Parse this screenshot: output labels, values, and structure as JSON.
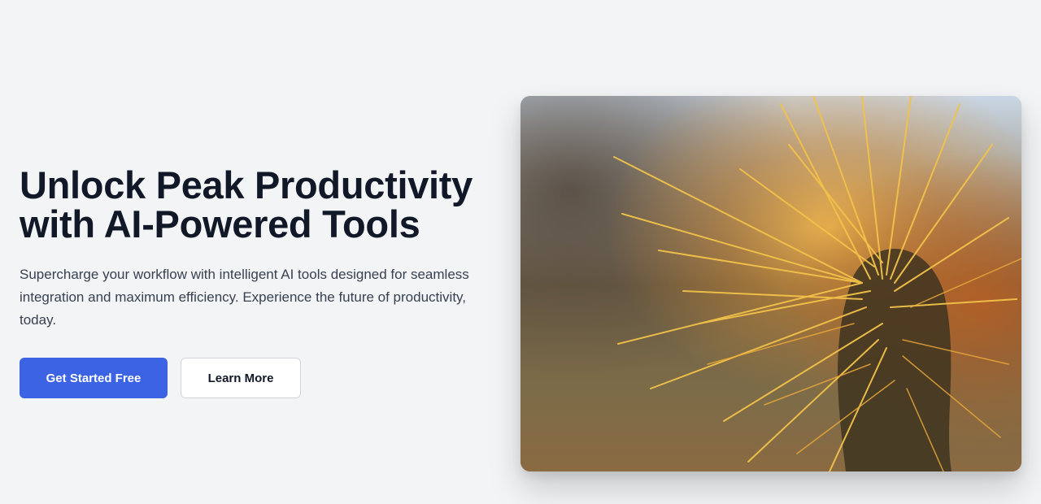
{
  "hero": {
    "headline_line1": "Unlock Peak Productivity",
    "headline_line2": "with AI-Powered Tools",
    "subtext": "Supercharge your workflow with intelligent AI tools designed for seamless integration and maximum efficiency. Experience the future of productivity, today.",
    "primary_cta": "Get Started Free",
    "secondary_cta": "Learn More",
    "image_subject": "cactus-spines-photo"
  },
  "colors": {
    "background": "#f3f4f6",
    "headline": "#111827",
    "body_text": "#374151",
    "primary_button": "#3b63e4",
    "primary_button_text": "#ffffff",
    "secondary_button_bg": "#ffffff",
    "secondary_button_border": "#d1d5db"
  }
}
